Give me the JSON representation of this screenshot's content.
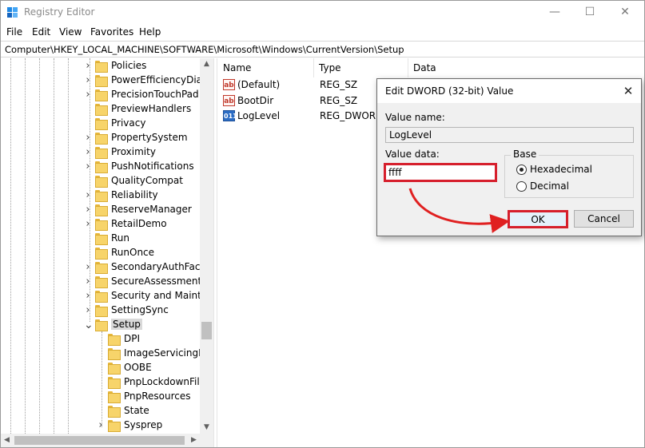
{
  "window": {
    "title": "Registry Editor",
    "controls": {
      "minimize": "—",
      "maximize": "☐",
      "close": "✕"
    }
  },
  "menu": [
    "File",
    "Edit",
    "View",
    "Favorites",
    "Help"
  ],
  "address": "Computer\\HKEY_LOCAL_MACHINE\\SOFTWARE\\Microsoft\\Windows\\CurrentVersion\\Setup",
  "tree": {
    "items": [
      {
        "label": "Policies",
        "expandable": true,
        "depth": 1
      },
      {
        "label": "PowerEfficiencyDiagr",
        "expandable": true,
        "depth": 1
      },
      {
        "label": "PrecisionTouchPad",
        "expandable": true,
        "depth": 1
      },
      {
        "label": "PreviewHandlers",
        "expandable": false,
        "depth": 1
      },
      {
        "label": "Privacy",
        "expandable": false,
        "depth": 1
      },
      {
        "label": "PropertySystem",
        "expandable": true,
        "depth": 1
      },
      {
        "label": "Proximity",
        "expandable": true,
        "depth": 1
      },
      {
        "label": "PushNotifications",
        "expandable": true,
        "depth": 1
      },
      {
        "label": "QualityCompat",
        "expandable": false,
        "depth": 1
      },
      {
        "label": "Reliability",
        "expandable": true,
        "depth": 1
      },
      {
        "label": "ReserveManager",
        "expandable": true,
        "depth": 1
      },
      {
        "label": "RetailDemo",
        "expandable": true,
        "depth": 1
      },
      {
        "label": "Run",
        "expandable": false,
        "depth": 1
      },
      {
        "label": "RunOnce",
        "expandable": false,
        "depth": 1
      },
      {
        "label": "SecondaryAuthFacto",
        "expandable": true,
        "depth": 1
      },
      {
        "label": "SecureAssessment",
        "expandable": true,
        "depth": 1
      },
      {
        "label": "Security and Mainter",
        "expandable": true,
        "depth": 1
      },
      {
        "label": "SettingSync",
        "expandable": true,
        "depth": 1
      },
      {
        "label": "Setup",
        "expandable": true,
        "expanded": true,
        "selected": true,
        "depth": 1
      },
      {
        "label": "DPI",
        "expandable": false,
        "depth": 2
      },
      {
        "label": "ImageServicingDa",
        "expandable": false,
        "depth": 2
      },
      {
        "label": "OOBE",
        "expandable": false,
        "depth": 2
      },
      {
        "label": "PnpLockdownFile",
        "expandable": false,
        "depth": 2
      },
      {
        "label": "PnpResources",
        "expandable": false,
        "depth": 2
      },
      {
        "label": "State",
        "expandable": false,
        "depth": 2
      },
      {
        "label": "Sysprep",
        "expandable": true,
        "depth": 2
      }
    ]
  },
  "values": {
    "columns": [
      "Name",
      "Type",
      "Data"
    ],
    "rows": [
      {
        "icon": "string-value-icon",
        "name": "(Default)",
        "type": "REG_SZ"
      },
      {
        "icon": "string-value-icon",
        "name": "BootDir",
        "type": "REG_SZ"
      },
      {
        "icon": "dword-value-icon",
        "name": "LogLevel",
        "type": "REG_DWORD"
      }
    ]
  },
  "dialog": {
    "title": "Edit DWORD (32-bit) Value",
    "value_name_label": "Value name:",
    "value_name": "LogLevel",
    "value_data_label": "Value data:",
    "value_data": "ffff",
    "base_label": "Base",
    "base_options": [
      "Hexadecimal",
      "Decimal"
    ],
    "base_selected": "Hexadecimal",
    "ok_label": "OK",
    "cancel_label": "Cancel"
  },
  "colors": {
    "highlight_red": "#d61f2c",
    "arrow_red": "#e02020",
    "folder_yellow": "#f7d46a"
  }
}
